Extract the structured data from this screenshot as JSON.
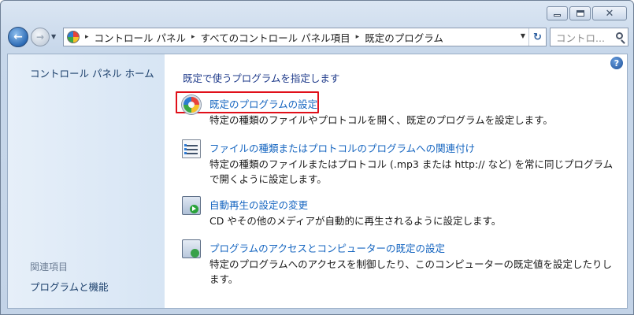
{
  "window": {
    "minimize_label": "",
    "maximize_label": "",
    "close_glyph": "✕"
  },
  "nav": {
    "back_glyph": "←",
    "forward_glyph": "→",
    "history_glyph": "▼",
    "breadcrumbs": [
      "コントロール パネル",
      "すべてのコントロール パネル項目",
      "既定のプログラム"
    ],
    "crumb_sep": "▸",
    "address_drop_glyph": "▼",
    "refresh_glyph": "↻",
    "search_placeholder": "コントロ..."
  },
  "sidebar": {
    "home_link": "コントロール パネル ホーム",
    "related_heading": "関連項目",
    "related_links": [
      "プログラムと機能"
    ]
  },
  "help": {
    "glyph": "?"
  },
  "main": {
    "title": "既定で使うプログラムを指定します",
    "tasks": [
      {
        "icon": "default-programs-icon",
        "link": "既定のプログラムの設定",
        "description": "特定の種類のファイルやプロトコルを開く、既定のプログラムを設定します。",
        "highlighted": true
      },
      {
        "icon": "file-association-icon",
        "link": "ファイルの種類またはプロトコルのプログラムへの関連付け",
        "description": "特定の種類のファイルまたはプロトコル (.mp3 または http:// など) を常に同じプログラムで開くように設定します。",
        "highlighted": false
      },
      {
        "icon": "autoplay-icon",
        "link": "自動再生の設定の変更",
        "description": "CD やその他のメディアが自動的に再生されるように設定します。",
        "highlighted": false
      },
      {
        "icon": "program-access-icon",
        "link": "プログラムのアクセスとコンピューターの既定の設定",
        "description": "特定のプログラムへのアクセスを制御したり、このコンピューターの既定値を設定したりします。",
        "highlighted": false
      }
    ]
  },
  "colors": {
    "link": "#1565c0",
    "highlight": "#e0101a",
    "sidebar_bg": "#dce8f5"
  }
}
